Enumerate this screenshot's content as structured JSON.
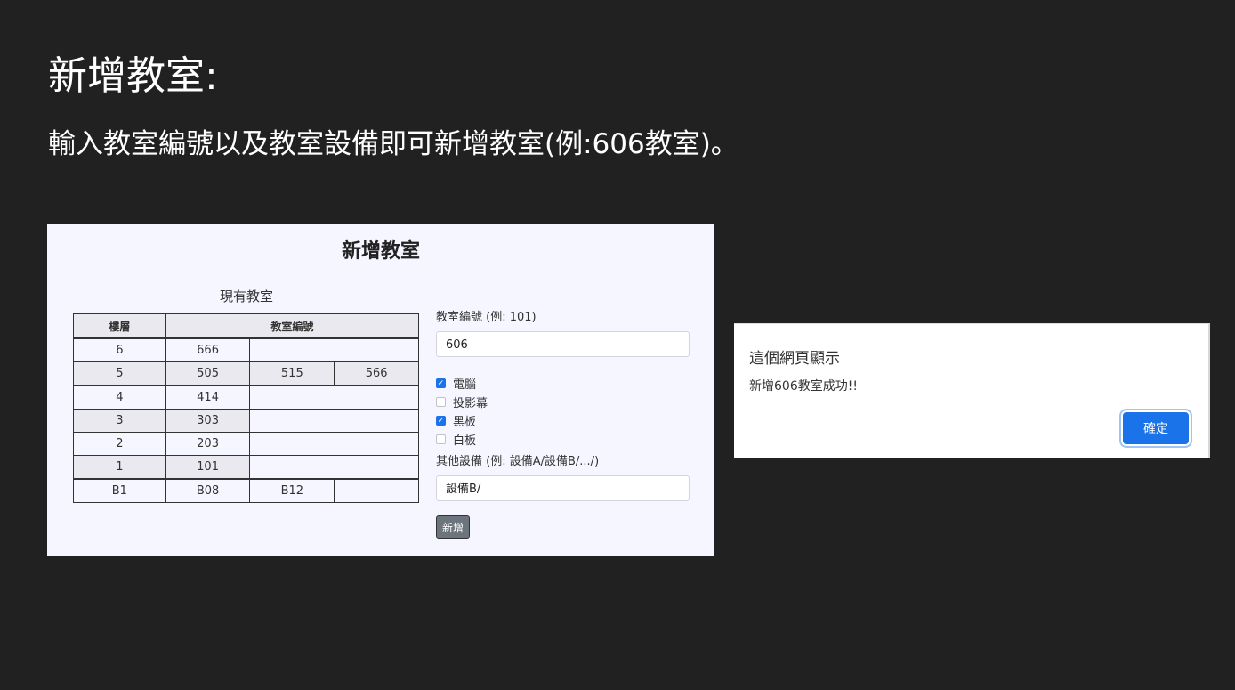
{
  "slide": {
    "title": "新增教室:",
    "description": "輸入教室編號以及教室設備即可新增教室(例:606教室)。"
  },
  "panel": {
    "heading": "新增教室",
    "table_caption": "現有教室",
    "table": {
      "headers": [
        "樓層",
        "教室編號"
      ],
      "rows": [
        {
          "floor": "6",
          "rooms": [
            "666",
            "",
            ""
          ]
        },
        {
          "floor": "5",
          "rooms": [
            "505",
            "515",
            "566"
          ]
        },
        {
          "floor": "4",
          "rooms": [
            "414",
            "",
            ""
          ]
        },
        {
          "floor": "3",
          "rooms": [
            "303",
            "",
            ""
          ]
        },
        {
          "floor": "2",
          "rooms": [
            "203",
            "",
            ""
          ]
        },
        {
          "floor": "1",
          "rooms": [
            "101",
            "",
            ""
          ]
        },
        {
          "floor": "B1",
          "rooms": [
            "B08",
            "B12",
            ""
          ]
        }
      ]
    },
    "form": {
      "room_label": "教室編號 (例: 101)",
      "room_value": "606",
      "equipment": [
        {
          "label": "電腦",
          "checked": true
        },
        {
          "label": "投影幕",
          "checked": false
        },
        {
          "label": "黑板",
          "checked": true
        },
        {
          "label": "白板",
          "checked": false
        }
      ],
      "other_label": "其他設備 (例: 設備A/設備B/.../)",
      "other_value": "設備B/",
      "submit_label": "新增"
    }
  },
  "dialog": {
    "title": "這個網頁顯示",
    "message": "新增606教室成功!!",
    "ok_label": "確定"
  },
  "colors": {
    "background": "#212121",
    "panel": "#f5f6ff",
    "accent": "#1a73e8",
    "submit_button": "#6c757d"
  }
}
